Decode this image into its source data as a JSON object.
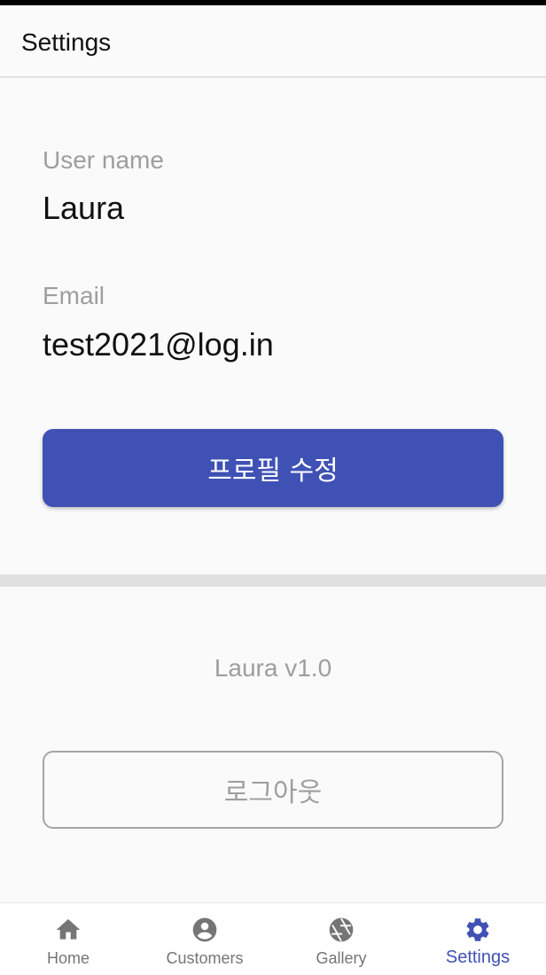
{
  "app_bar": {
    "title": "Settings"
  },
  "profile": {
    "username_label": "User name",
    "username_value": "Laura",
    "email_label": "Email",
    "email_value": "test2021@log.in",
    "edit_button_label": "프로필 수정"
  },
  "footer": {
    "version": "Laura v1.0",
    "logout_label": "로그아웃"
  },
  "bottom_nav": {
    "items": [
      {
        "label": "Home",
        "icon": "home-icon"
      },
      {
        "label": "Customers",
        "icon": "account-circle-icon"
      },
      {
        "label": "Gallery",
        "icon": "camera-shutter-icon"
      },
      {
        "label": "Settings",
        "icon": "gear-icon",
        "active": true
      }
    ]
  },
  "colors": {
    "primary": "#3f51b5",
    "muted_text": "#9e9e9e",
    "nav_inactive": "#757575"
  }
}
